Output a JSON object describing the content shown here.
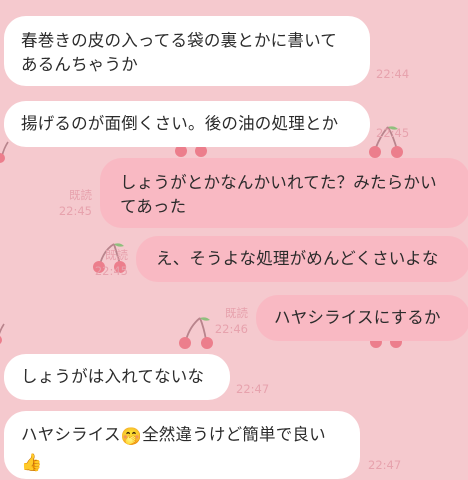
{
  "theme": {
    "background": "#f5c9ce",
    "incoming_bubble": "#ffffff",
    "outgoing_bubble": "#f9b9c3",
    "meta_text": "#e7a2ad",
    "cherry": "#e86b7b"
  },
  "messages": [
    {
      "side": "in",
      "lines": [
        "春巻きの皮の入ってる袋の裏とかに書いて",
        "あるんちゃうか"
      ],
      "time": "22:44"
    },
    {
      "side": "in",
      "lines": [
        "揚げるのが面倒くさい。後の油の処理とか"
      ],
      "time": "22:45"
    },
    {
      "side": "out",
      "lines": [
        "しょうがとかなんかいれてた？みたらかい",
        "てあった"
      ],
      "read": "既読",
      "time": "22:45"
    },
    {
      "side": "out",
      "lines": [
        "え、そうよな処理がめんどくさいよな"
      ],
      "read": "既読",
      "time": "22:45"
    },
    {
      "side": "out",
      "lines": [
        "ハヤシライスにするか"
      ],
      "read": "既読",
      "time": "22:46"
    },
    {
      "side": "in",
      "lines": [
        "しょうがは入れてないな"
      ],
      "time": "22:47"
    },
    {
      "side": "in",
      "line1_text": "ハヤシライス",
      "line1_emoji": "🤭",
      "line1_rest": "全然違うけど簡単で良い",
      "line2_emoji": "👍",
      "time": "22:47"
    }
  ],
  "icons": {
    "cherry": "cherry-icon"
  }
}
